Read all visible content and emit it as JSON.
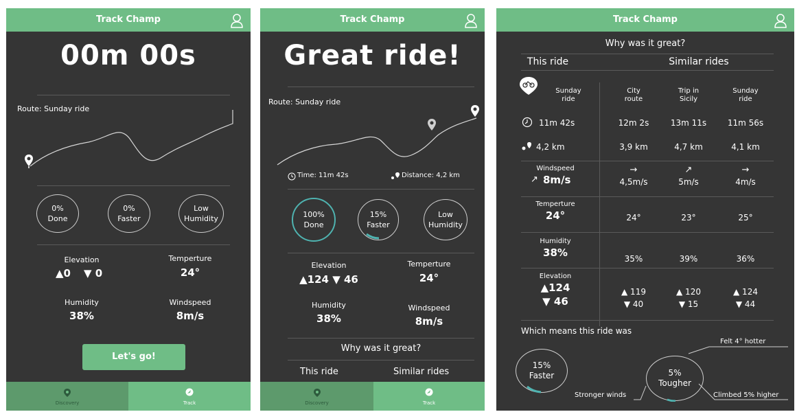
{
  "app": {
    "title": "Track Champ"
  },
  "nav": {
    "discovery_label": "Discovery",
    "track_label": "Track"
  },
  "screen1": {
    "timer": "00m 00s",
    "route": "Route: Sunday ride",
    "rings": [
      {
        "line1": "0%",
        "line2": "Done"
      },
      {
        "line1": "0%",
        "line2": "Faster"
      },
      {
        "line1": "Low",
        "line2": "Humidity"
      }
    ],
    "elevation_label": "Elevation",
    "elevation_up": "▲0",
    "elevation_down": "▼ 0",
    "temperature_label": "Temperture",
    "temperature_value": "24°",
    "humidity_label": "Humidity",
    "humidity_value": "38%",
    "windspeed_label": "Windspeed",
    "windspeed_value": "8m/s",
    "go_button": "Let's go!"
  },
  "screen2": {
    "headline": "Great ride!",
    "route": "Route: Sunday ride",
    "time_label": "Time: 11m 42s",
    "distance_label": "Distance: 4,2 km",
    "rings": [
      {
        "line1": "100%",
        "line2": "Done",
        "progress": 1.0
      },
      {
        "line1": "15%",
        "line2": "Faster",
        "progress": 0.15
      },
      {
        "line1": "Low",
        "line2": "Humidity",
        "progress": 0
      }
    ],
    "elevation_label": "Elevation",
    "elevation_value": "▲124 ▼ 46",
    "temperature_label": "Temperture",
    "temperature_value": "24°",
    "humidity_label": "Humidity",
    "humidity_value": "38%",
    "windspeed_label": "Windspeed",
    "windspeed_value": "8m/s",
    "why_title": "Why was it great?",
    "this_ride": "This ride",
    "similar_rides": "Similar rides"
  },
  "screen3": {
    "why_title": "Why was it great?",
    "this_ride": "This ride",
    "similar_rides": "Similar rides",
    "columns": {
      "this_line1": "Sunday",
      "this_line2": "ride",
      "sim": [
        {
          "line1": "City",
          "line2": "route"
        },
        {
          "line1": "Trip in",
          "line2": "Sicily"
        },
        {
          "line1": "Sunday",
          "line2": "ride"
        }
      ]
    },
    "times": {
      "this": "11m 42s",
      "sim": [
        "12m 2s",
        "13m 11s",
        "11m 56s"
      ]
    },
    "distances": {
      "this": "4,2 km",
      "sim": [
        "3,9 km",
        "4,7 km",
        "4,1 km"
      ]
    },
    "windspeed": {
      "label": "Windspeed",
      "this": "8m/s",
      "this_arrow": "↗",
      "sim": [
        "4,5m/s",
        "5m/s",
        "4m/s"
      ],
      "sim_arrows": [
        "→",
        "↗",
        "→"
      ]
    },
    "temperature": {
      "label": "Temperture",
      "this": "24°",
      "sim": [
        "24°",
        "23°",
        "25°"
      ]
    },
    "humidity": {
      "label": "Humidity",
      "this": "38%",
      "sim": [
        "35%",
        "39%",
        "36%"
      ]
    },
    "elevation": {
      "label": "Elevation",
      "this_up": "▲124",
      "this_down": "▼ 46",
      "sim_up": [
        "▲ 119",
        "▲ 120",
        "▲ 124"
      ],
      "sim_down": [
        "▼ 40",
        "▼ 15",
        "▼ 44"
      ]
    },
    "means_title": "Which means this ride was",
    "faster_line1": "15%",
    "faster_line2": "Faster",
    "tougher_line1": "5%",
    "tougher_line2": "Tougher",
    "faster_progress": 0.15,
    "tougher_progress": 0.05,
    "note_hotter": "Felt 4° hotter",
    "note_winds": "Stronger winds",
    "note_climbed": "Climbed 5% higher"
  },
  "colors": {
    "accent": "#6fbd86",
    "background": "#353535",
    "ring_progress": "#4fb3b0"
  }
}
